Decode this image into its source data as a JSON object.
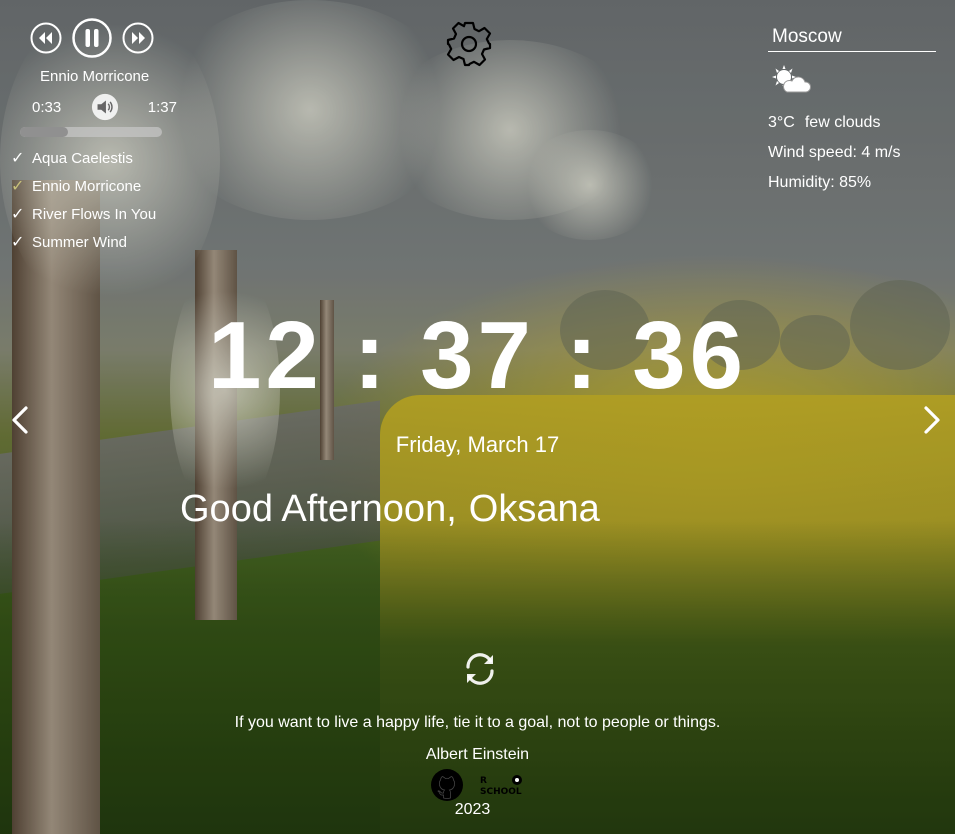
{
  "player": {
    "prev_icon": "rewind-icon",
    "play_icon": "pause-icon",
    "next_icon": "fast-forward-icon",
    "now_playing": "Ennio Morricone",
    "current_time": "0:33",
    "duration": "1:37",
    "volume_icon": "speaker-icon",
    "progress": 0.34,
    "playlist": [
      {
        "title": "Aqua Caelestis",
        "active": false
      },
      {
        "title": "Ennio Morricone",
        "active": true
      },
      {
        "title": "River Flows In You",
        "active": false
      },
      {
        "title": "Summer Wind",
        "active": false
      }
    ]
  },
  "settings": {
    "icon": "gear-icon"
  },
  "weather": {
    "city": "Moscow",
    "icon": "sun-behind-cloud-icon",
    "temperature": "3°C",
    "description": "few clouds",
    "wind": "Wind speed: 4 m/s",
    "humidity": "Humidity: 85%"
  },
  "slider": {
    "prev_icon": "chevron-left-icon",
    "next_icon": "chevron-right-icon"
  },
  "clock": {
    "time": "12:37:36",
    "date": "Friday, March 17"
  },
  "greeting": {
    "text": "Good Afternoon,",
    "name": "Oksana"
  },
  "quote": {
    "refresh_icon": "refresh-icon",
    "text": "If you want to live a happy life, tie it to a goal, not to people or things.",
    "author": "Albert Einstein"
  },
  "footer": {
    "github_icon": "github-icon",
    "rss_logo": "rs-school-logo",
    "year": "2023"
  }
}
